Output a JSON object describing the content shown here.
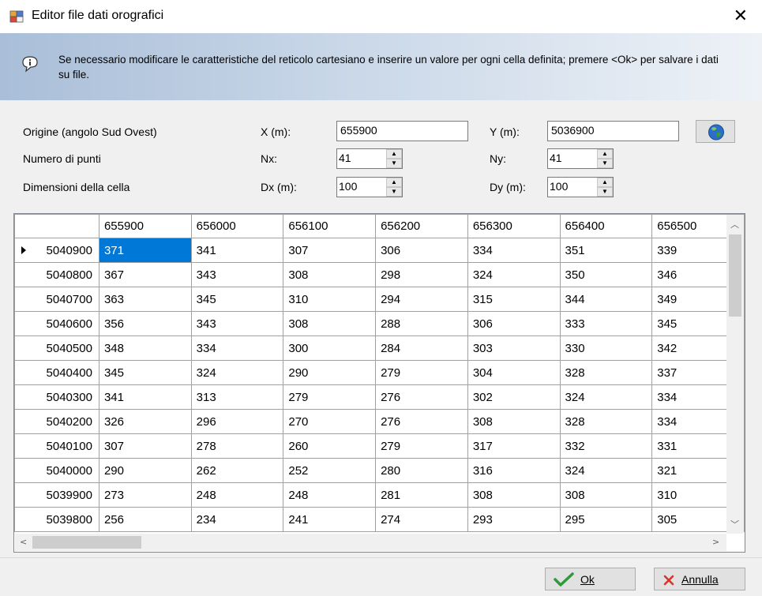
{
  "window": {
    "title": "Editor file dati orografici",
    "close_glyph": "✕"
  },
  "banner": {
    "text": "Se necessario modificare le caratteristiche del reticolo cartesiano e inserire un valore per ogni cella definita; premere <Ok> per salvare i dati su file."
  },
  "form": {
    "origin_label": "Origine (angolo Sud Ovest)",
    "points_label": "Numero di punti",
    "cell_label": "Dimensioni della cella",
    "x_label": "X (m):",
    "x_value": "655900",
    "y_label": "Y (m):",
    "y_value": "5036900",
    "nx_label": "Nx:",
    "nx_value": "41",
    "ny_label": "Ny:",
    "ny_value": "41",
    "dx_label": "Dx (m):",
    "dx_value": "100",
    "dy_label": "Dy (m):",
    "dy_value": "100"
  },
  "grid": {
    "columns": [
      "655900",
      "656000",
      "656100",
      "656200",
      "656300",
      "656400",
      "656500"
    ],
    "rows": [
      {
        "y": "5040900",
        "cells": [
          "371",
          "341",
          "307",
          "306",
          "334",
          "351",
          "339"
        ]
      },
      {
        "y": "5040800",
        "cells": [
          "367",
          "343",
          "308",
          "298",
          "324",
          "350",
          "346"
        ]
      },
      {
        "y": "5040700",
        "cells": [
          "363",
          "345",
          "310",
          "294",
          "315",
          "344",
          "349"
        ]
      },
      {
        "y": "5040600",
        "cells": [
          "356",
          "343",
          "308",
          "288",
          "306",
          "333",
          "345"
        ]
      },
      {
        "y": "5040500",
        "cells": [
          "348",
          "334",
          "300",
          "284",
          "303",
          "330",
          "342"
        ]
      },
      {
        "y": "5040400",
        "cells": [
          "345",
          "324",
          "290",
          "279",
          "304",
          "328",
          "337"
        ]
      },
      {
        "y": "5040300",
        "cells": [
          "341",
          "313",
          "279",
          "276",
          "302",
          "324",
          "334"
        ]
      },
      {
        "y": "5040200",
        "cells": [
          "326",
          "296",
          "270",
          "276",
          "308",
          "328",
          "334"
        ]
      },
      {
        "y": "5040100",
        "cells": [
          "307",
          "278",
          "260",
          "279",
          "317",
          "332",
          "331"
        ]
      },
      {
        "y": "5040000",
        "cells": [
          "290",
          "262",
          "252",
          "280",
          "316",
          "324",
          "321"
        ]
      },
      {
        "y": "5039900",
        "cells": [
          "273",
          "248",
          "248",
          "281",
          "308",
          "308",
          "310"
        ]
      },
      {
        "y": "5039800",
        "cells": [
          "256",
          "234",
          "241",
          "274",
          "293",
          "295",
          "305"
        ]
      }
    ]
  },
  "buttons": {
    "ok_label": "Ok",
    "cancel_label": "Annulla"
  },
  "colors": {
    "selection": "#0078d7",
    "ok_check": "#2e9b3b",
    "cancel_x": "#d9332b"
  }
}
